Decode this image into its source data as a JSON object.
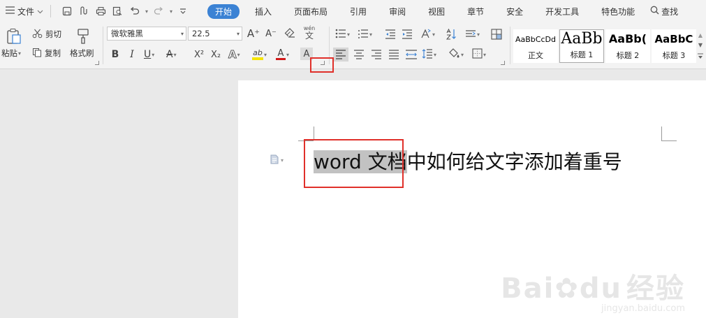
{
  "menubar": {
    "file_label": "文件",
    "tabs": [
      "开始",
      "插入",
      "页面布局",
      "引用",
      "审阅",
      "视图",
      "章节",
      "安全",
      "开发工具",
      "特色功能"
    ],
    "active_tab": "开始",
    "search_label": "查找"
  },
  "clipboard": {
    "paste_label": "粘贴",
    "cut_label": "剪切",
    "copy_label": "复制",
    "format_painter_label": "格式刷"
  },
  "font": {
    "family": "微软雅黑",
    "size": "22.5",
    "pinyin_glyph": "wén",
    "bold": "B",
    "italic": "I",
    "underline": "U",
    "strikethrough": "A",
    "superscript": "X²",
    "subscript": "X₂",
    "effects": "A",
    "highlight": "ab",
    "color": "A",
    "shading": "A",
    "grow": "A⁺",
    "shrink": "A⁻"
  },
  "styles": [
    {
      "sample": "AaBbCcDd",
      "name": "正文"
    },
    {
      "sample": "AaBb",
      "name": "标题 1"
    },
    {
      "sample": "AaBb(",
      "name": "标题 2"
    },
    {
      "sample": "AaBbC",
      "name": "标题 3"
    }
  ],
  "document": {
    "selected_text": "word 文档",
    "rest_text": "中如何给文字添加着重号"
  },
  "watermark": {
    "brand": "Bai",
    "brand_suffix": "du",
    "brand_cn": "经验",
    "url": "jingyan.baidu.com"
  },
  "colors": {
    "accent": "#3b82d4",
    "highlight_bar": "#f5e400",
    "font_color_bar": "#d11a1a",
    "annotation": "#e0302a",
    "selection": "#c2c2c2"
  }
}
